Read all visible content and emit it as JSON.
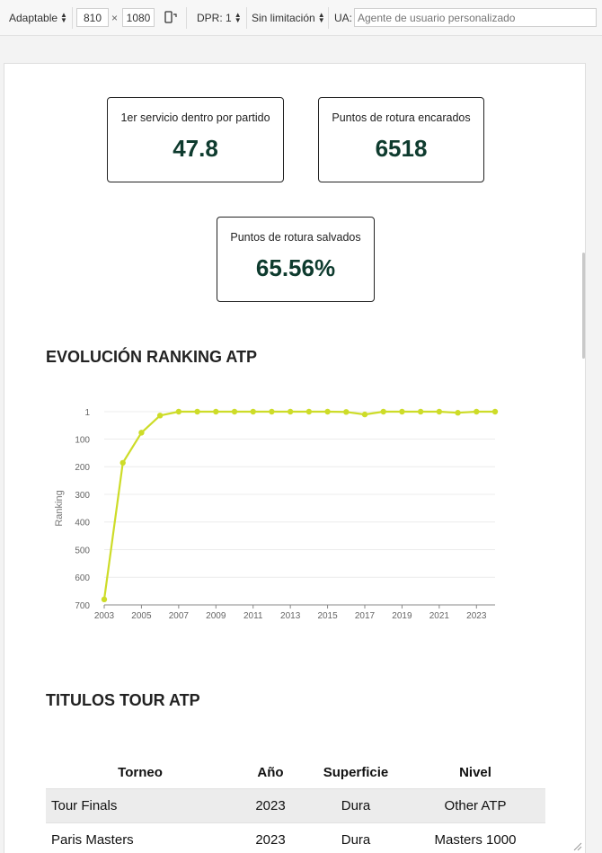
{
  "toolbar": {
    "device_mode": "Adaptable",
    "width": "810",
    "times": "×",
    "height": "1080",
    "dpr": "DPR: 1",
    "throttling": "Sin limitación",
    "ua_label": "UA:",
    "ua_placeholder": "Agente de usuario personalizado"
  },
  "stats": [
    {
      "label": "1er servicio dentro por partido",
      "value": "47.8"
    },
    {
      "label": "Puntos de rotura encarados",
      "value": "6518"
    },
    {
      "label": "Puntos de rotura salvados",
      "value": "65.56%"
    }
  ],
  "ranking_title": "EVOLUCIÓN RANKING ATP",
  "chart_data": {
    "type": "line",
    "title": "",
    "xlabel": "",
    "ylabel": "Ranking",
    "y_inverted": true,
    "ylim": [
      1,
      700
    ],
    "y_ticks": [
      "1",
      "100",
      "200",
      "300",
      "400",
      "500",
      "600",
      "700"
    ],
    "x_ticks": [
      "2003",
      "2005",
      "2007",
      "2009",
      "2011",
      "2013",
      "2015",
      "2017",
      "2019",
      "2021",
      "2023"
    ],
    "grid": true,
    "color": "#cddc28",
    "x": [
      2003,
      2004,
      2005,
      2006,
      2007,
      2008,
      2009,
      2010,
      2011,
      2012,
      2013,
      2014,
      2015,
      2016,
      2017,
      2018,
      2019,
      2020,
      2021,
      2022,
      2023,
      2024
    ],
    "values": [
      680,
      186,
      77,
      15,
      1,
      1,
      1,
      1,
      1,
      1,
      1,
      1,
      1,
      2,
      11,
      1,
      1,
      1,
      1,
      5,
      1,
      1
    ]
  },
  "titles_title": "TITULOS TOUR ATP",
  "table": {
    "headers": [
      "Torneo",
      "Año",
      "Superficie",
      "Nivel"
    ],
    "rows": [
      [
        "Tour Finals",
        "2023",
        "Dura",
        "Other ATP"
      ],
      [
        "Paris Masters",
        "2023",
        "Dura",
        "Masters 1000"
      ]
    ]
  }
}
